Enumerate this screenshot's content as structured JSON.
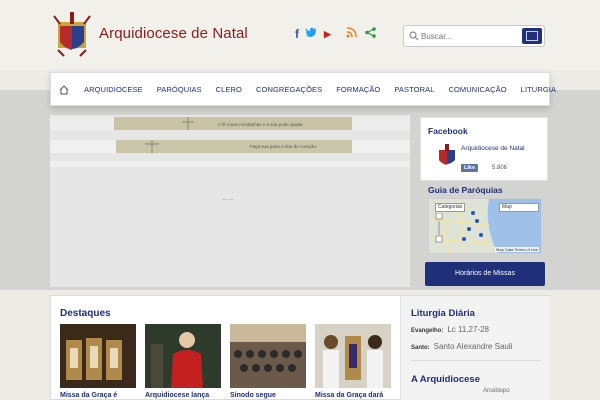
{
  "header": {
    "site_title": "Arquidiocese de Natal",
    "logo_icon": "coat-of-arms-icon",
    "social": [
      {
        "name": "facebook-icon",
        "glyph": "f",
        "color": "#3b5998"
      },
      {
        "name": "twitter-icon",
        "glyph": "🐦",
        "color": "#1da1f2"
      },
      {
        "name": "youtube-icon",
        "glyph": "▶",
        "color": "#cc1f1f"
      }
    ],
    "extras": [
      {
        "name": "rss-icon",
        "color": "#f58220"
      },
      {
        "name": "share-icon",
        "color": "#2a9d3a"
      }
    ],
    "search": {
      "placeholder": "Buscar..."
    }
  },
  "nav": {
    "home_icon": "home-icon",
    "items": [
      "ARQUIDIOCESE",
      "PARÓQUIAS",
      "CLERO",
      "CONGREGAÇÕES",
      "FORMAÇÃO",
      "PASTORAL",
      "COMUNICAÇÃO",
      "LITURGIA"
    ]
  },
  "slider": {
    "caption_1": "A fé move montanhas e a sua pode ajudar.",
    "caption_2": "Faça sua parte e doe de coração."
  },
  "facebook": {
    "title": "Facebook",
    "page_name": "Arquidiocese de Natal",
    "like_label": "Like",
    "like_count": "5.806"
  },
  "guia": {
    "title": "Guia de Paróquias",
    "select_category": "Categorias",
    "select_map": "Map",
    "map_footer": "Map Data  Terms of Use"
  },
  "horarios": {
    "label": "Horários de Missas"
  },
  "destaques": {
    "title": "Destaques",
    "items": [
      {
        "caption": "Missa da Graça é"
      },
      {
        "caption": "Arquidiocese lança"
      },
      {
        "caption": "Sínodo segue"
      },
      {
        "caption": "Missa da Graça dará"
      }
    ]
  },
  "liturgia": {
    "title": "Liturgia Diária",
    "evangelho_label": "Evangelho:",
    "evangelho_value": "Lc 11,27-28",
    "santo_label": "Santo:",
    "santo_value": "Santo Alexandre Sauli"
  },
  "arquidiocese_section": {
    "title": "A Arquidiocese",
    "snippet": "Arcebispo"
  },
  "colors": {
    "brand_red": "#8a1c1c",
    "brand_blue": "#1f2f7a"
  }
}
